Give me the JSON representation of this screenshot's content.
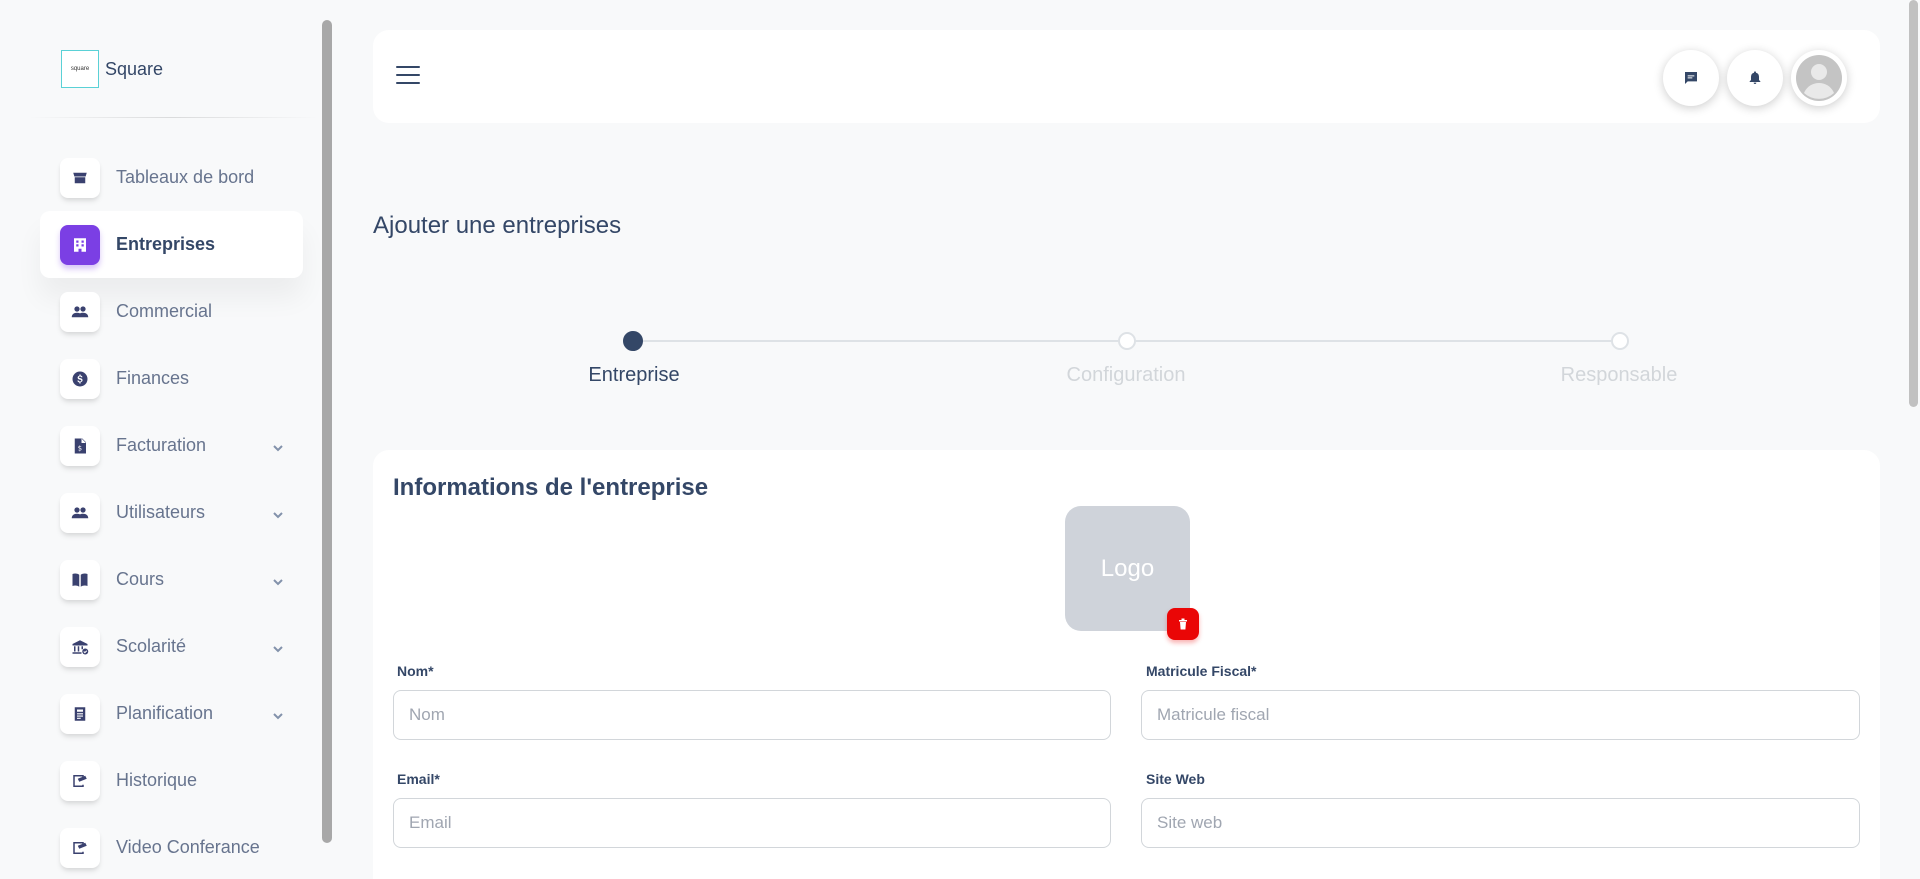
{
  "brand": {
    "logo_text": "square",
    "name": "Square"
  },
  "sidebar": {
    "items": [
      {
        "label": "Tableaux de bord",
        "icon": "store-icon",
        "active": false,
        "has_chevron": false
      },
      {
        "label": "Entreprises",
        "icon": "building-icon",
        "active": true,
        "has_chevron": false
      },
      {
        "label": "Commercial",
        "icon": "people-icon",
        "active": false,
        "has_chevron": false
      },
      {
        "label": "Finances",
        "icon": "dollar-icon",
        "active": false,
        "has_chevron": false
      },
      {
        "label": "Facturation",
        "icon": "invoice-icon",
        "active": false,
        "has_chevron": true
      },
      {
        "label": "Utilisateurs",
        "icon": "users-icon",
        "active": false,
        "has_chevron": true
      },
      {
        "label": "Cours",
        "icon": "book-icon",
        "active": false,
        "has_chevron": true
      },
      {
        "label": "Scolarité",
        "icon": "institution-icon",
        "active": false,
        "has_chevron": true
      },
      {
        "label": "Planification",
        "icon": "newspaper-icon",
        "active": false,
        "has_chevron": true
      },
      {
        "label": "Historique",
        "icon": "history-icon",
        "active": false,
        "has_chevron": false
      },
      {
        "label": "Video Conferance",
        "icon": "video-icon",
        "active": false,
        "has_chevron": false
      }
    ]
  },
  "header": {
    "actions": [
      "chat-icon",
      "bell-icon",
      "avatar"
    ]
  },
  "page": {
    "title": "Ajouter une entreprises"
  },
  "stepper": {
    "steps": [
      {
        "label": "Entreprise",
        "state": "active"
      },
      {
        "label": "Configuration",
        "state": "pending"
      },
      {
        "label": "Responsable",
        "state": "pending"
      }
    ]
  },
  "form": {
    "title": "Informations de l'entreprise",
    "logo_placeholder": "Logo",
    "fields": {
      "nom": {
        "label": "Nom*",
        "placeholder": "Nom",
        "value": ""
      },
      "matricule": {
        "label": "Matricule Fiscal*",
        "placeholder": "Matricule fiscal",
        "value": ""
      },
      "email": {
        "label": "Email*",
        "placeholder": "Email",
        "value": ""
      },
      "site": {
        "label": "Site Web",
        "placeholder": "Site web",
        "value": ""
      }
    }
  },
  "colors": {
    "accent": "#7b3fe4",
    "text": "#344767",
    "danger": "#ea0606"
  }
}
